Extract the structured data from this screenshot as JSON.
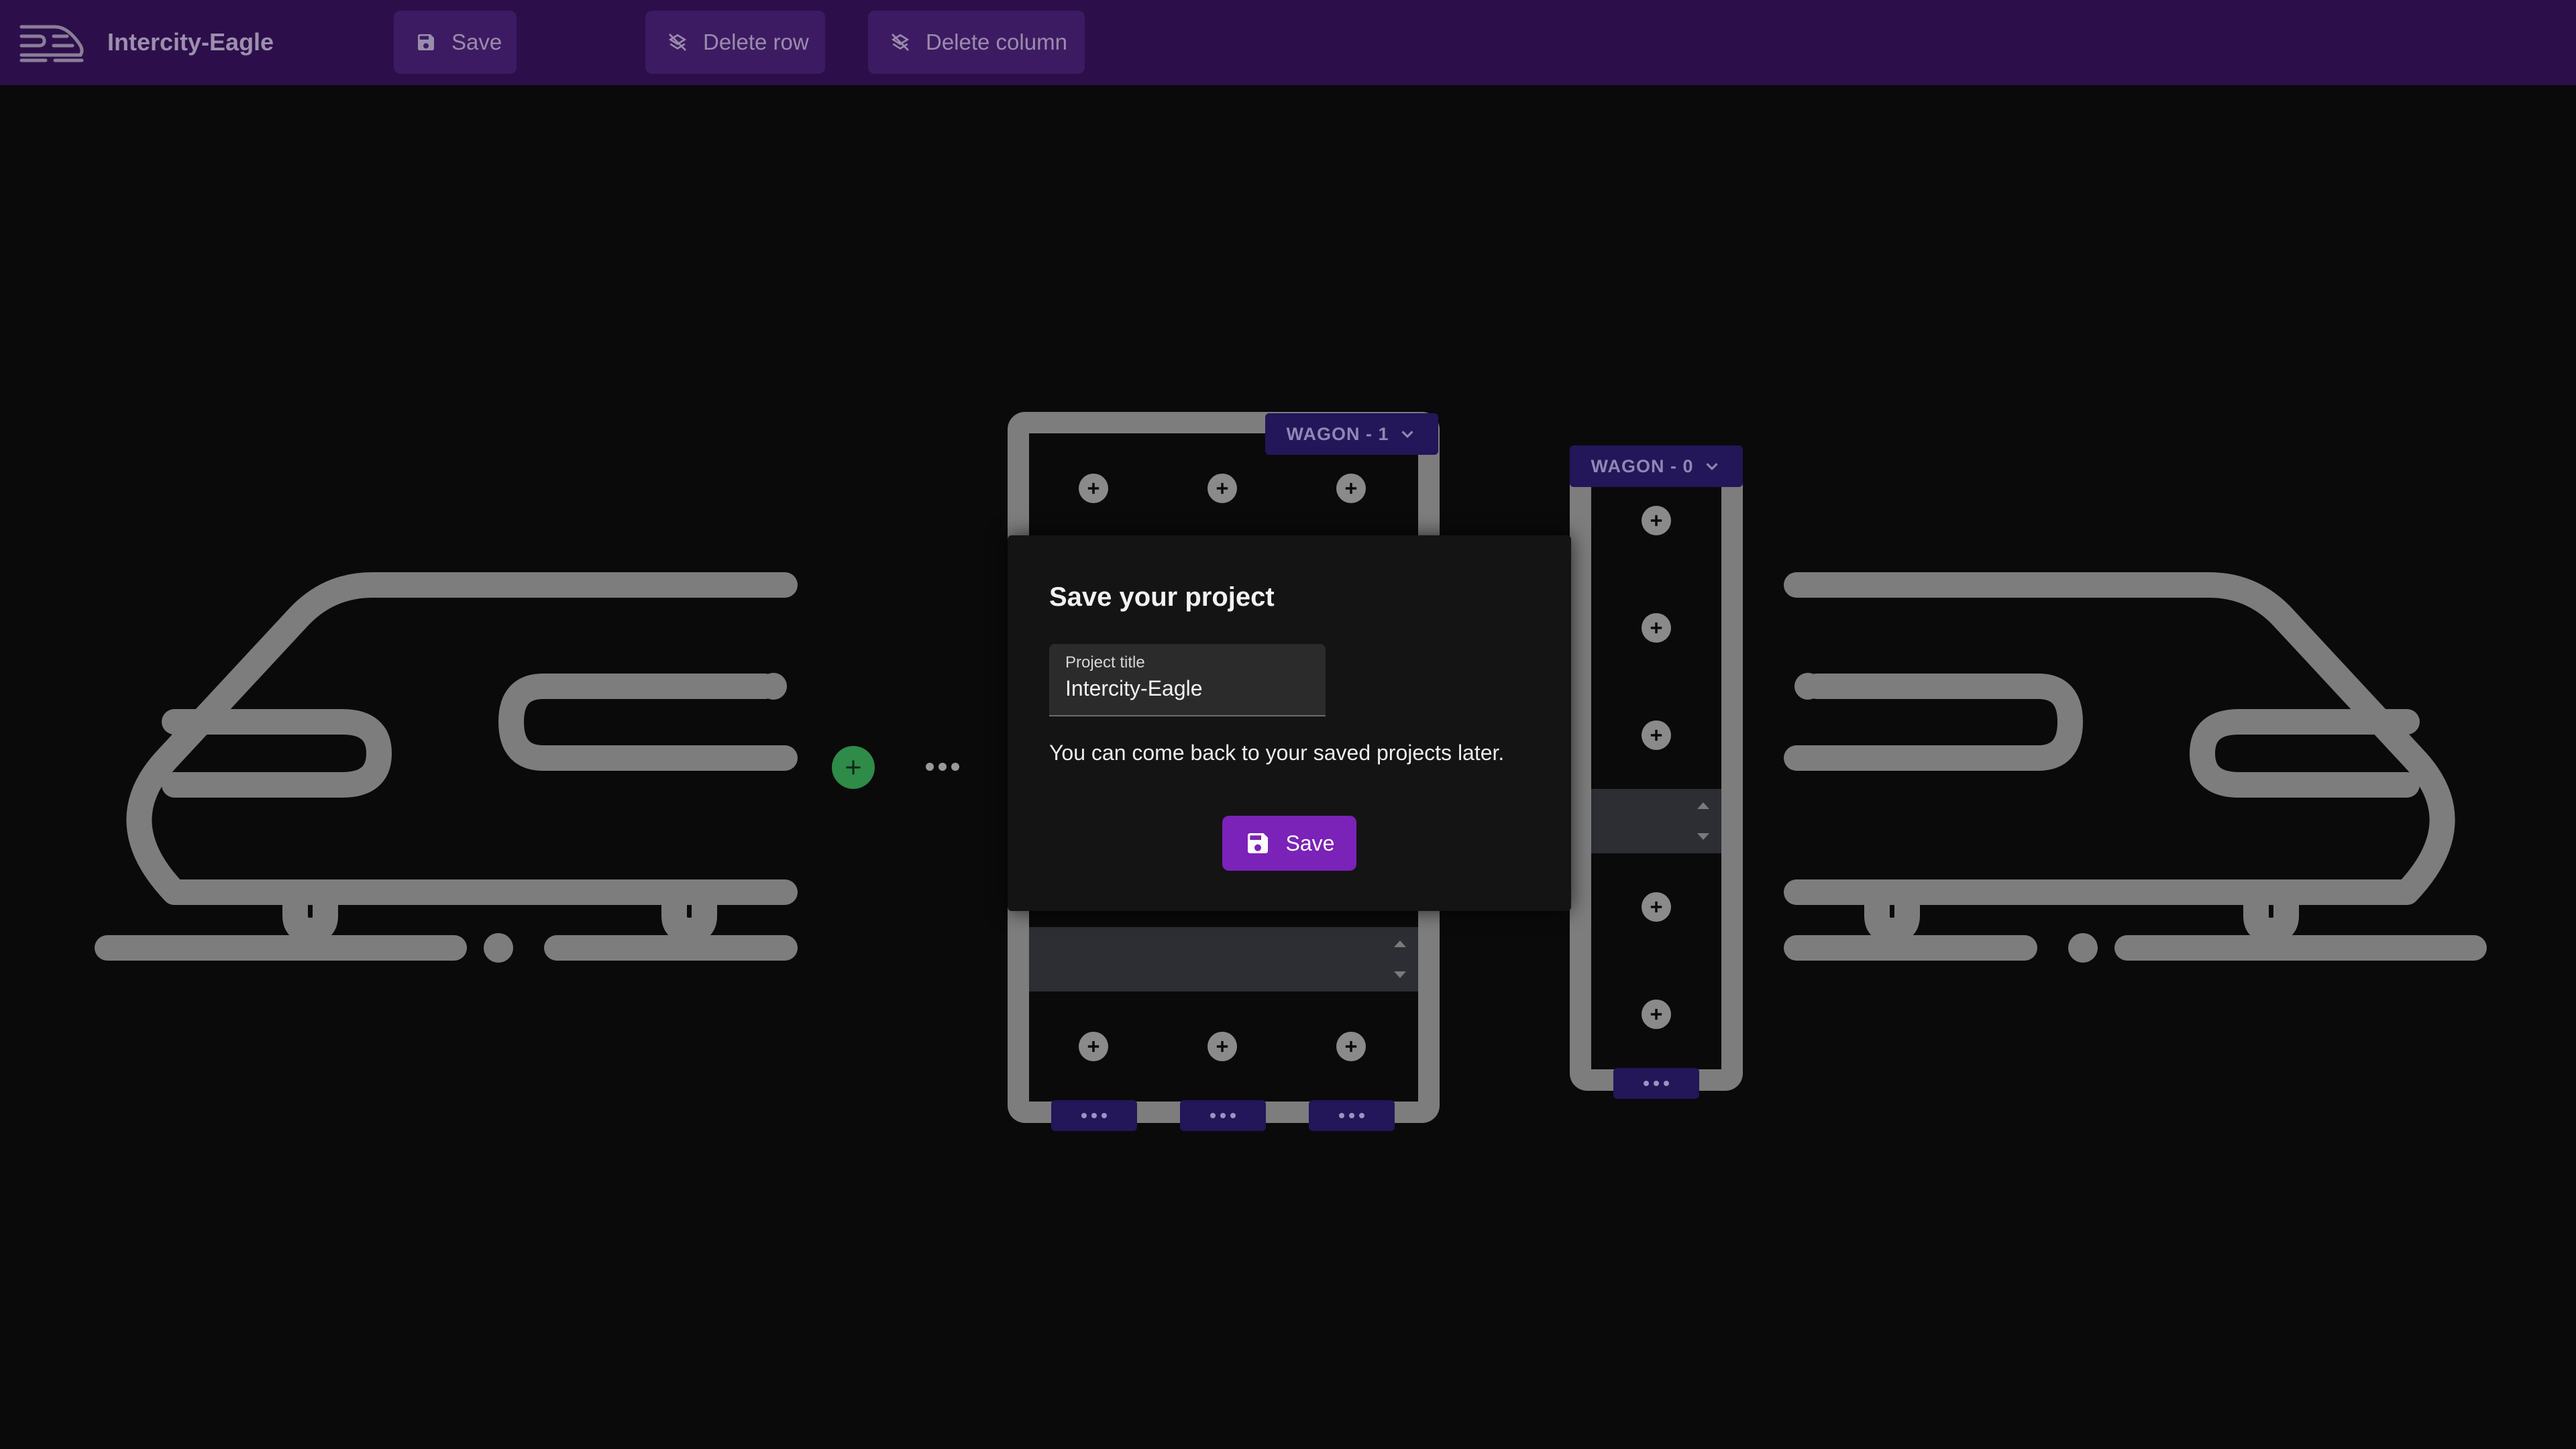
{
  "app": {
    "title": "Intercity-Eagle"
  },
  "toolbar": {
    "save_label": "Save",
    "delete_row_label": "Delete row",
    "delete_column_label": "Delete column"
  },
  "wagons": [
    {
      "label": "WAGON - 1"
    },
    {
      "label": "WAGON - 0"
    }
  ],
  "dialog": {
    "title": "Save your project",
    "field_label": "Project title",
    "field_value": "Intercity-Eagle",
    "message": "You can come back to your saved projects later.",
    "save_label": "Save"
  },
  "colors": {
    "topbar": "#2c0f4a",
    "accent": "#7b22b8",
    "wagon_tag": "#231659",
    "add_green": "#2e8b48",
    "frame_gray": "#7d7d7d"
  }
}
